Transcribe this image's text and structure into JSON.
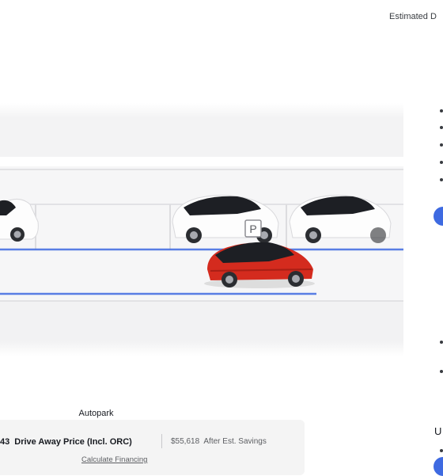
{
  "header": {
    "estimated_delivery": "Estimated D"
  },
  "hero": {
    "parking_sign": "P",
    "caption": "Autopark",
    "colors": {
      "featured_car": "#d42b1e",
      "parked_cars": "#ffffff",
      "guide_lines": "#3e6ae1",
      "background": "#f2f2f3"
    }
  },
  "pricing": {
    "price_prefix": "43",
    "price_label": "Drive Away Price (Incl. ORC)",
    "savings_amount": "$55,618",
    "savings_label": "After Est. Savings",
    "financing_link": "Calculate Financing"
  },
  "right_column": {
    "upgrade_heading": "U",
    "accent_color": "#3e6ae1"
  }
}
